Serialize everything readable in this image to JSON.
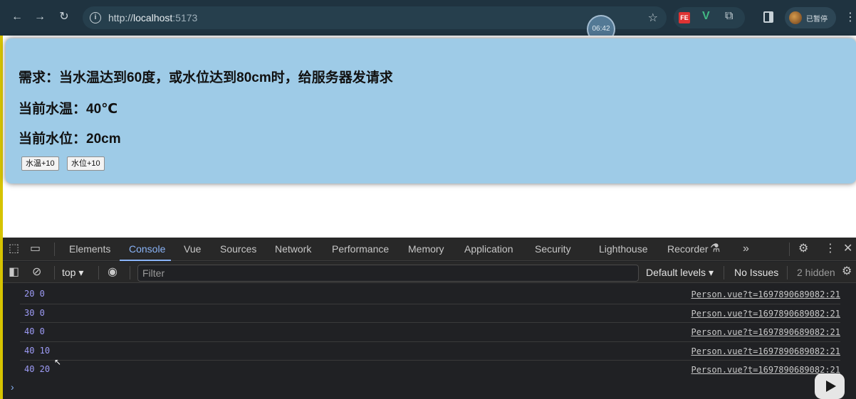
{
  "browser": {
    "url_scheme": "http://",
    "url_host": "localhost",
    "url_port": ":5173",
    "timer_badge": "06:42",
    "profile_label": "已暂停",
    "extensions": [
      "FE",
      "V"
    ]
  },
  "page": {
    "requirement": "需求：当水温达到60度，或水位达到80cm时，给服务器发请求",
    "temperature_label": "当前水温：40℃",
    "water_level_label": "当前水位：20cm",
    "buttons": {
      "temp_plus": "水温+10",
      "level_plus": "水位+10"
    }
  },
  "devtools": {
    "tabs": [
      "Elements",
      "Console",
      "Vue",
      "Sources",
      "Network",
      "Performance",
      "Memory",
      "Application",
      "Security",
      "Lighthouse",
      "Recorder"
    ],
    "active_tab": "Console",
    "context": "top",
    "filter_placeholder": "Filter",
    "levels_label": "Default levels",
    "issues_label": "No Issues",
    "hidden_label": "2 hidden",
    "logs": [
      {
        "message": "20 0",
        "source": "Person.vue?t=1697890689082:21"
      },
      {
        "message": "30 0",
        "source": "Person.vue?t=1697890689082:21"
      },
      {
        "message": "40 0",
        "source": "Person.vue?t=1697890689082:21"
      },
      {
        "message": "40 10",
        "source": "Person.vue?t=1697890689082:21"
      },
      {
        "message": "40 20",
        "source": "Person.vue?t=1697890689082:21"
      }
    ]
  },
  "colors": {
    "card_bg": "#9ecbe7",
    "chrome_bg": "#1f3340",
    "devtools_bg": "#202124",
    "log_value": "#9e9cf7",
    "active_tab": "#8ab4f8"
  }
}
